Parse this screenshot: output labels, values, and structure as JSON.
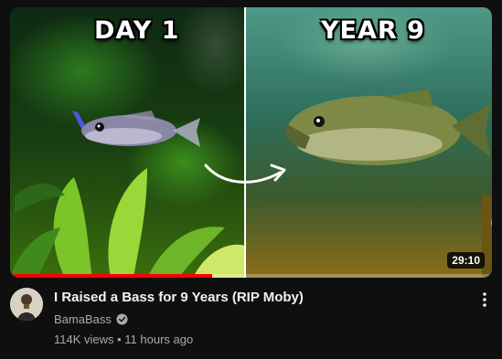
{
  "video": {
    "thumbnail": {
      "left_label": "DAY 1",
      "right_label": "YEAR 9"
    },
    "duration": "29:10",
    "watch_progress": 0.42,
    "title": "I Raised a Bass for 9 Years (RIP Moby)",
    "channel": "BamaBass",
    "views": "114K views",
    "age": "11 hours ago",
    "meta_separator": " • "
  },
  "colors": {
    "background": "#0f0f0f",
    "progress": "#ff0000",
    "secondary_text": "#aaaaaa",
    "primary_text": "#f1f1f1"
  },
  "icons": {
    "verified": "verified-badge-icon",
    "more": "more-vert-icon",
    "arrow": "curved-arrow-icon"
  }
}
